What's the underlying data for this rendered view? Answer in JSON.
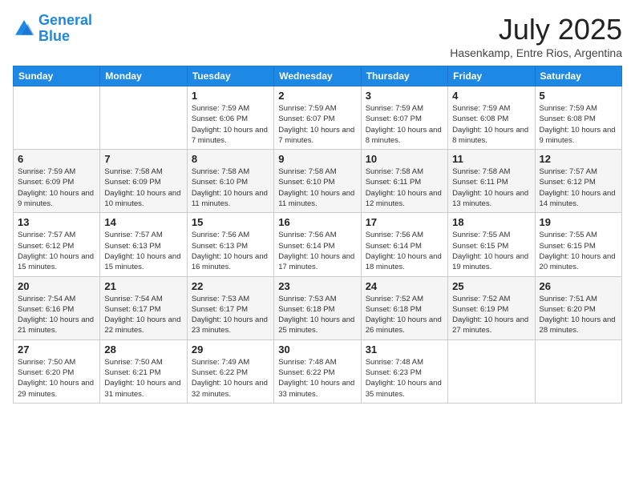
{
  "header": {
    "logo_line1": "General",
    "logo_line2": "Blue",
    "month_title": "July 2025",
    "location": "Hasenkamp, Entre Rios, Argentina"
  },
  "days_of_week": [
    "Sunday",
    "Monday",
    "Tuesday",
    "Wednesday",
    "Thursday",
    "Friday",
    "Saturday"
  ],
  "weeks": [
    [
      {
        "day": "",
        "info": ""
      },
      {
        "day": "",
        "info": ""
      },
      {
        "day": "1",
        "info": "Sunrise: 7:59 AM\nSunset: 6:06 PM\nDaylight: 10 hours and 7 minutes."
      },
      {
        "day": "2",
        "info": "Sunrise: 7:59 AM\nSunset: 6:07 PM\nDaylight: 10 hours and 7 minutes."
      },
      {
        "day": "3",
        "info": "Sunrise: 7:59 AM\nSunset: 6:07 PM\nDaylight: 10 hours and 8 minutes."
      },
      {
        "day": "4",
        "info": "Sunrise: 7:59 AM\nSunset: 6:08 PM\nDaylight: 10 hours and 8 minutes."
      },
      {
        "day": "5",
        "info": "Sunrise: 7:59 AM\nSunset: 6:08 PM\nDaylight: 10 hours and 9 minutes."
      }
    ],
    [
      {
        "day": "6",
        "info": "Sunrise: 7:59 AM\nSunset: 6:09 PM\nDaylight: 10 hours and 9 minutes."
      },
      {
        "day": "7",
        "info": "Sunrise: 7:58 AM\nSunset: 6:09 PM\nDaylight: 10 hours and 10 minutes."
      },
      {
        "day": "8",
        "info": "Sunrise: 7:58 AM\nSunset: 6:10 PM\nDaylight: 10 hours and 11 minutes."
      },
      {
        "day": "9",
        "info": "Sunrise: 7:58 AM\nSunset: 6:10 PM\nDaylight: 10 hours and 11 minutes."
      },
      {
        "day": "10",
        "info": "Sunrise: 7:58 AM\nSunset: 6:11 PM\nDaylight: 10 hours and 12 minutes."
      },
      {
        "day": "11",
        "info": "Sunrise: 7:58 AM\nSunset: 6:11 PM\nDaylight: 10 hours and 13 minutes."
      },
      {
        "day": "12",
        "info": "Sunrise: 7:57 AM\nSunset: 6:12 PM\nDaylight: 10 hours and 14 minutes."
      }
    ],
    [
      {
        "day": "13",
        "info": "Sunrise: 7:57 AM\nSunset: 6:12 PM\nDaylight: 10 hours and 15 minutes."
      },
      {
        "day": "14",
        "info": "Sunrise: 7:57 AM\nSunset: 6:13 PM\nDaylight: 10 hours and 15 minutes."
      },
      {
        "day": "15",
        "info": "Sunrise: 7:56 AM\nSunset: 6:13 PM\nDaylight: 10 hours and 16 minutes."
      },
      {
        "day": "16",
        "info": "Sunrise: 7:56 AM\nSunset: 6:14 PM\nDaylight: 10 hours and 17 minutes."
      },
      {
        "day": "17",
        "info": "Sunrise: 7:56 AM\nSunset: 6:14 PM\nDaylight: 10 hours and 18 minutes."
      },
      {
        "day": "18",
        "info": "Sunrise: 7:55 AM\nSunset: 6:15 PM\nDaylight: 10 hours and 19 minutes."
      },
      {
        "day": "19",
        "info": "Sunrise: 7:55 AM\nSunset: 6:15 PM\nDaylight: 10 hours and 20 minutes."
      }
    ],
    [
      {
        "day": "20",
        "info": "Sunrise: 7:54 AM\nSunset: 6:16 PM\nDaylight: 10 hours and 21 minutes."
      },
      {
        "day": "21",
        "info": "Sunrise: 7:54 AM\nSunset: 6:17 PM\nDaylight: 10 hours and 22 minutes."
      },
      {
        "day": "22",
        "info": "Sunrise: 7:53 AM\nSunset: 6:17 PM\nDaylight: 10 hours and 23 minutes."
      },
      {
        "day": "23",
        "info": "Sunrise: 7:53 AM\nSunset: 6:18 PM\nDaylight: 10 hours and 25 minutes."
      },
      {
        "day": "24",
        "info": "Sunrise: 7:52 AM\nSunset: 6:18 PM\nDaylight: 10 hours and 26 minutes."
      },
      {
        "day": "25",
        "info": "Sunrise: 7:52 AM\nSunset: 6:19 PM\nDaylight: 10 hours and 27 minutes."
      },
      {
        "day": "26",
        "info": "Sunrise: 7:51 AM\nSunset: 6:20 PM\nDaylight: 10 hours and 28 minutes."
      }
    ],
    [
      {
        "day": "27",
        "info": "Sunrise: 7:50 AM\nSunset: 6:20 PM\nDaylight: 10 hours and 29 minutes."
      },
      {
        "day": "28",
        "info": "Sunrise: 7:50 AM\nSunset: 6:21 PM\nDaylight: 10 hours and 31 minutes."
      },
      {
        "day": "29",
        "info": "Sunrise: 7:49 AM\nSunset: 6:22 PM\nDaylight: 10 hours and 32 minutes."
      },
      {
        "day": "30",
        "info": "Sunrise: 7:48 AM\nSunset: 6:22 PM\nDaylight: 10 hours and 33 minutes."
      },
      {
        "day": "31",
        "info": "Sunrise: 7:48 AM\nSunset: 6:23 PM\nDaylight: 10 hours and 35 minutes."
      },
      {
        "day": "",
        "info": ""
      },
      {
        "day": "",
        "info": ""
      }
    ]
  ]
}
